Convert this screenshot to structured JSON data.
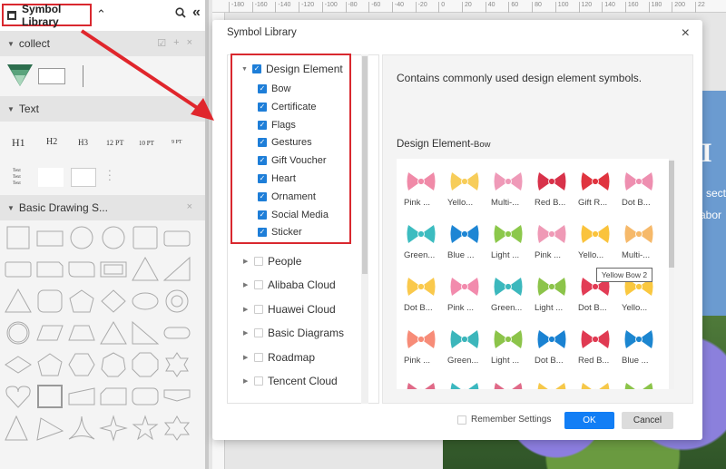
{
  "left_panel": {
    "title": "Symbol Library",
    "sections": [
      {
        "label": "collect"
      },
      {
        "label": "Text"
      },
      {
        "label": "Basic Drawing S..."
      }
    ],
    "text_samples": [
      "H1",
      "H2",
      "H3",
      "12 PT",
      "10 PT",
      "9 PT"
    ],
    "text_block_lines": [
      "Text",
      "Text",
      "Text"
    ]
  },
  "ruler": {
    "ticks": [
      "-180",
      "-160",
      "-140",
      "-120",
      "-100",
      "-80",
      "-60",
      "-40",
      "-20",
      "0",
      "20",
      "40",
      "60",
      "80",
      "100",
      "120",
      "140",
      "160",
      "180",
      "200",
      "22"
    ]
  },
  "canvas": {
    "text_line1": "sect",
    "text_line2": "abor",
    "heading": "I"
  },
  "dialog": {
    "title": "Symbol Library",
    "close": "×",
    "tree": {
      "expanded": {
        "label": "Design Element",
        "checked": true,
        "children": [
          {
            "label": "Bow",
            "checked": true
          },
          {
            "label": "Certificate",
            "checked": true
          },
          {
            "label": "Flags",
            "checked": true
          },
          {
            "label": "Gestures",
            "checked": true
          },
          {
            "label": "Gift Voucher",
            "checked": true
          },
          {
            "label": "Heart",
            "checked": true
          },
          {
            "label": "Ornament",
            "checked": true
          },
          {
            "label": "Social Media",
            "checked": true
          },
          {
            "label": "Sticker",
            "checked": true
          }
        ]
      },
      "collapsed": [
        {
          "label": "People",
          "checked": false
        },
        {
          "label": "Alibaba Cloud",
          "checked": false
        },
        {
          "label": "Huawei Cloud",
          "checked": false
        },
        {
          "label": "Basic Diagrams",
          "checked": false
        },
        {
          "label": "Roadmap",
          "checked": false
        },
        {
          "label": "Tencent Cloud",
          "checked": false
        }
      ]
    },
    "description": "Contains commonly used design element symbols.",
    "library_name": "Design Element-",
    "library_sub": "Bow",
    "symbols": [
      {
        "label": "Pink ...",
        "color": "#f08aa8"
      },
      {
        "label": "Yello...",
        "color": "#f7cd5a"
      },
      {
        "label": "Multi-...",
        "color": "#ef9ab8"
      },
      {
        "label": "Red B...",
        "color": "#d8324a"
      },
      {
        "label": "Gift R...",
        "color": "#e0343f"
      },
      {
        "label": "Dot B...",
        "color": "#ee8fb0"
      },
      {
        "label": "Green...",
        "color": "#3cbcc0"
      },
      {
        "label": "Blue ...",
        "color": "#1e86d4"
      },
      {
        "label": "Light ...",
        "color": "#8cc84b"
      },
      {
        "label": "Pink ...",
        "color": "#ef9ab6"
      },
      {
        "label": "Yello...",
        "color": "#fac33c"
      },
      {
        "label": "Multi-...",
        "color": "#f6b96a"
      },
      {
        "label": "Dot B...",
        "color": "#fac94c"
      },
      {
        "label": "Pink ...",
        "color": "#f28bad"
      },
      {
        "label": "Green...",
        "color": "#3cb8bd"
      },
      {
        "label": "Light ...",
        "color": "#8cc44a"
      },
      {
        "label": "Dot B...",
        "color": "#e23c55"
      },
      {
        "label": "Yello...",
        "color": "#fac840"
      },
      {
        "label": "Pink ...",
        "color": "#f78c78"
      },
      {
        "label": "Green...",
        "color": "#3cb6bb"
      },
      {
        "label": "Light ...",
        "color": "#8cc44a"
      },
      {
        "label": "Dot B...",
        "color": "#1a82d2"
      },
      {
        "label": "Red B...",
        "color": "#e03a52"
      },
      {
        "label": "Blue ...",
        "color": "#1c86d0"
      },
      {
        "label": "",
        "color": "#e06a88"
      },
      {
        "label": "",
        "color": "#3cb8c0"
      },
      {
        "label": "",
        "color": "#e06a88"
      },
      {
        "label": "",
        "color": "#f6c84a"
      },
      {
        "label": "",
        "color": "#f6c84a"
      },
      {
        "label": "",
        "color": "#8cc44a"
      }
    ],
    "tooltip": "Yellow Bow 2",
    "remember_label": "Remember Settings",
    "remember_checked": false,
    "ok_label": "OK",
    "cancel_label": "Cancel"
  },
  "colors": {
    "accent": "#127ef5",
    "highlight": "#d9282f",
    "checkbox": "#1e7ed8"
  }
}
